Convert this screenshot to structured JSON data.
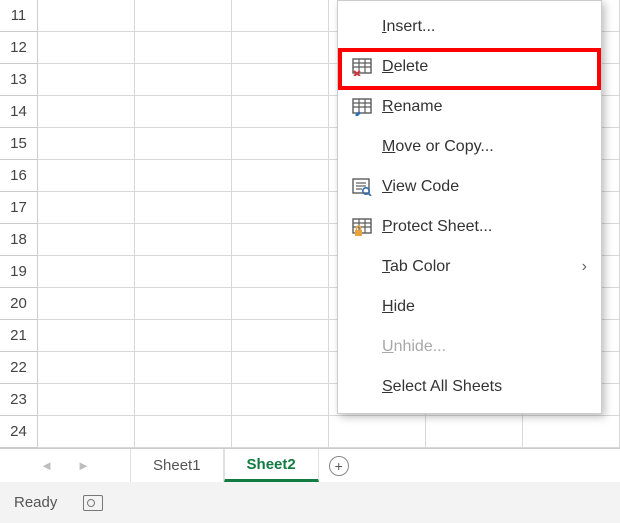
{
  "rows": [
    "11",
    "12",
    "13",
    "14",
    "15",
    "16",
    "17",
    "18",
    "19",
    "20",
    "21",
    "22",
    "23",
    "24"
  ],
  "tabs": {
    "sheet1": "Sheet1",
    "sheet2": "Sheet2"
  },
  "status": {
    "ready": "Ready"
  },
  "menu": {
    "insert": {
      "pre": "",
      "u": "I",
      "post": "nsert..."
    },
    "delete": {
      "pre": "",
      "u": "D",
      "post": "elete"
    },
    "rename": {
      "pre": "",
      "u": "R",
      "post": "ename"
    },
    "move": {
      "pre": "",
      "u": "M",
      "post": "ove or Copy..."
    },
    "viewcode": {
      "pre": "",
      "u": "V",
      "post": "iew Code"
    },
    "protect": {
      "pre": "",
      "u": "P",
      "post": "rotect Sheet..."
    },
    "tabcolor": {
      "pre": "",
      "u": "T",
      "post": "ab Color"
    },
    "hide": {
      "pre": "",
      "u": "H",
      "post": "ide"
    },
    "unhide": {
      "pre": "",
      "u": "U",
      "post": "nhide..."
    },
    "selectall": {
      "pre": "",
      "u": "S",
      "post": "elect All Sheets"
    }
  },
  "icons": {
    "grid_stroke": "#5b5b5b",
    "accent_red": "#d13438",
    "accent_blue": "#2f6fb0",
    "accent_orange": "#e8a33d"
  }
}
